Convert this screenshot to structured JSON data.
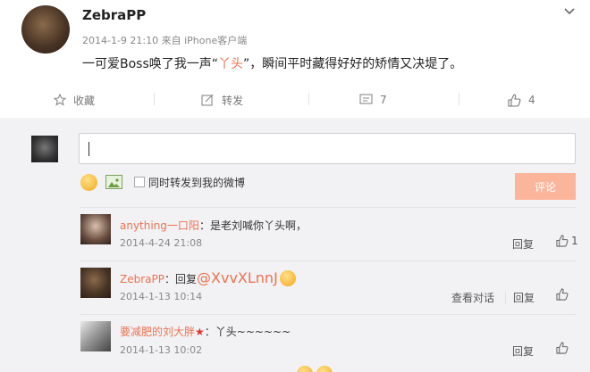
{
  "post": {
    "username": "ZebraPP",
    "meta": "2014-1-9 21:10 来自 iPhone客户端",
    "content_prefix": "一可爱Boss唤了我一声“",
    "content_highlight": "丫头",
    "content_suffix": "”，瞬间平时藏得好好的矫情又决堤了。",
    "actions": {
      "favorite_label": "收藏",
      "repost_label": "转发",
      "comment_count": "7",
      "like_count": "4"
    }
  },
  "composer": {
    "input_value": "",
    "sync_label": "同时转发到我的微博",
    "submit_label": "评论"
  },
  "comments": [
    {
      "name": "anything一口阳",
      "sep": "：",
      "text": "是老刘喊你丫头啊，",
      "time": "2014-4-24 21:08",
      "reply_label": "回复",
      "like_count": "1"
    },
    {
      "name": "ZebraPP",
      "sep": "：",
      "reply_prefix": "回复",
      "mention": "@XvvXLnnJ",
      "time": "2014-1-13 10:14",
      "view_label": "查看对话",
      "reply_label": "回复"
    },
    {
      "name": "要减肥的刘大胖",
      "badge": "★",
      "sep": "：",
      "text": "丫头~~~~~~",
      "time": "2014-1-13 10:02",
      "reply_label": "回复"
    }
  ],
  "colors": {
    "accent": "#eb7350",
    "submit_bg": "#fbb59b",
    "panel_bg": "#f2f2f5"
  }
}
